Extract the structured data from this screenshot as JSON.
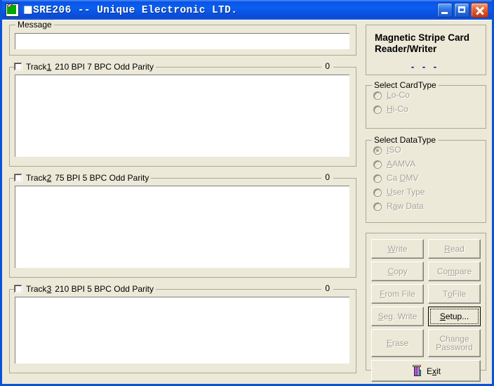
{
  "window": {
    "title_prefix": "■",
    "title": "SRE206 -- Unique Electronic LTD.",
    "icon": "card-writer-icon",
    "minimize_label": "Minimize",
    "maximize_label": "Maximize",
    "close_label": "Close"
  },
  "message": {
    "legend": "Message",
    "value": "",
    "placeholder": ""
  },
  "tracks": [
    {
      "name": "Track1",
      "accel": "1",
      "spec": "210 BPI  7 BPC  Odd Parity",
      "counter": "0",
      "checked": false,
      "value": ""
    },
    {
      "name": "Track2",
      "accel": "2",
      "spec": "75 BPI  5 BPC  Odd Parity",
      "counter": "0",
      "checked": false,
      "value": ""
    },
    {
      "name": "Track3",
      "accel": "3",
      "spec": "210 BPI  5 BPC  Odd Parity",
      "counter": "0",
      "checked": false,
      "value": ""
    }
  ],
  "device": {
    "title_line1": "Magnetic Stripe Card",
    "title_line2": "Reader/Writer",
    "status": "- - -",
    "status_color": "#00007e"
  },
  "card_type": {
    "legend": "Select CardType",
    "options": [
      {
        "label": "Lo-Co",
        "accel": "L",
        "selected": false,
        "enabled": false
      },
      {
        "label": "Hi-Co",
        "accel": "H",
        "selected": false,
        "enabled": false
      }
    ]
  },
  "data_type": {
    "legend": "Select DataType",
    "options": [
      {
        "label": "ISO",
        "accel": "I",
        "selected": true,
        "enabled": false
      },
      {
        "label": "AAMVA",
        "accel": "A",
        "selected": false,
        "enabled": false
      },
      {
        "label": "Ca DMV",
        "accel": "D",
        "selected": false,
        "enabled": false
      },
      {
        "label": "User Type",
        "accel": "U",
        "selected": false,
        "enabled": false
      },
      {
        "label": "Raw Data",
        "accel": "a",
        "selected": false,
        "enabled": false
      }
    ]
  },
  "buttons": [
    {
      "label": "Write",
      "enabled": false,
      "focused": false
    },
    {
      "label": "Read",
      "enabled": false,
      "focused": false
    },
    {
      "label": "Copy",
      "enabled": false,
      "focused": false
    },
    {
      "label": "Compare",
      "enabled": false,
      "focused": false
    },
    {
      "label": "From File",
      "enabled": false,
      "focused": false
    },
    {
      "label": "To File",
      "enabled": false,
      "focused": false
    },
    {
      "label": "Seg. Write",
      "enabled": false,
      "focused": false
    },
    {
      "label": "Setup...",
      "enabled": true,
      "focused": true
    },
    {
      "label": "Erase",
      "enabled": false,
      "focused": false
    },
    {
      "label": "Change\nPassword",
      "enabled": false,
      "focused": false
    }
  ],
  "exit": {
    "label": "Exit",
    "icon": "exit-door-icon",
    "enabled": true
  },
  "colors": {
    "window_face": "#ece9d8",
    "title_blue": "#0a52e8",
    "frame_blue": "#0a46c8",
    "disabled_text": "#a7a398",
    "field_white": "#ffffff"
  }
}
